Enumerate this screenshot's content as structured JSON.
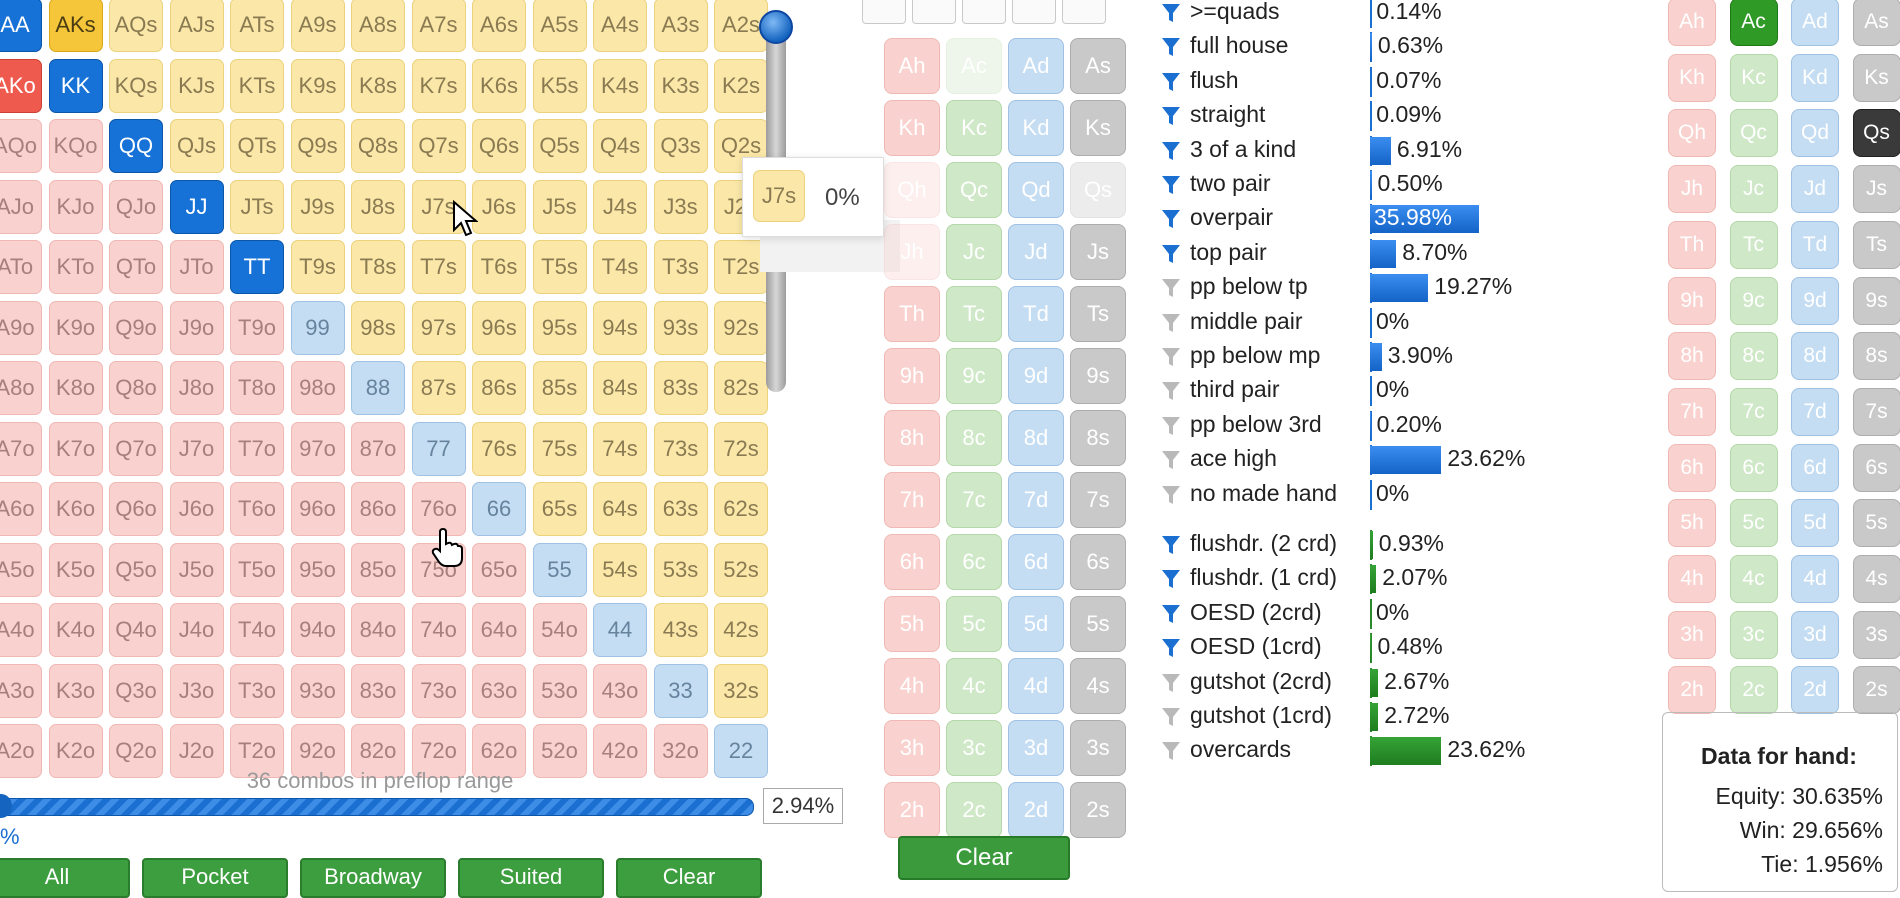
{
  "grid": {
    "ranks": [
      "A",
      "K",
      "Q",
      "J",
      "T",
      "9",
      "8",
      "7",
      "6",
      "5",
      "4",
      "3",
      "2"
    ],
    "selected": {
      "AA": "sel-blue",
      "AKs": "sel-gold",
      "AKo": "sel-red",
      "KK": "sel-blue",
      "QQ": "sel-blue",
      "JJ": "sel-blue",
      "TT": "sel-blue"
    }
  },
  "tooltip": {
    "hand": "J7s",
    "pct": "0%"
  },
  "combos_text": "36 combos in preflop range",
  "range_pct": "2.94%",
  "range_pct_left": "%",
  "range_buttons": [
    "All",
    "Pocket",
    "Broadway",
    "Suited",
    "Clear"
  ],
  "board": {
    "ranks": [
      "A",
      "K",
      "Q",
      "J",
      "T",
      "9",
      "8",
      "7",
      "6",
      "5",
      "4",
      "3",
      "2"
    ],
    "suits": [
      "h",
      "c",
      "d",
      "s"
    ],
    "dimmed": [
      "Ac",
      "Qh",
      "Qs",
      "Jh"
    ],
    "clear_label": "Clear"
  },
  "stats": {
    "made": [
      {
        "label": ">=quads",
        "value": "0.14%",
        "pct": 0.14,
        "filter": "blue"
      },
      {
        "label": "full house",
        "value": "0.63%",
        "pct": 0.63,
        "filter": "blue"
      },
      {
        "label": "flush",
        "value": "0.07%",
        "pct": 0.07,
        "filter": "blue"
      },
      {
        "label": "straight",
        "value": "0.09%",
        "pct": 0.09,
        "filter": "blue"
      },
      {
        "label": "3 of a kind",
        "value": "6.91%",
        "pct": 6.91,
        "filter": "blue"
      },
      {
        "label": "two pair",
        "value": "0.50%",
        "pct": 0.5,
        "filter": "blue"
      },
      {
        "label": "overpair",
        "value": "35.98%",
        "pct": 35.98,
        "filter": "blue"
      },
      {
        "label": "top pair",
        "value": "8.70%",
        "pct": 8.7,
        "filter": "blue"
      },
      {
        "label": "pp below tp",
        "value": "19.27%",
        "pct": 19.27,
        "filter": "gray"
      },
      {
        "label": "middle pair",
        "value": "0%",
        "pct": 0,
        "filter": "gray"
      },
      {
        "label": "pp below mp",
        "value": "3.90%",
        "pct": 3.9,
        "filter": "gray"
      },
      {
        "label": "third pair",
        "value": "0%",
        "pct": 0,
        "filter": "gray"
      },
      {
        "label": "pp below 3rd",
        "value": "0.20%",
        "pct": 0.2,
        "filter": "gray"
      },
      {
        "label": "ace high",
        "value": "23.62%",
        "pct": 23.62,
        "filter": "gray"
      },
      {
        "label": "no made hand",
        "value": "0%",
        "pct": 0,
        "filter": "gray"
      }
    ],
    "draws": [
      {
        "label": "flushdr. (2 crd)",
        "value": "0.93%",
        "pct": 0.93,
        "filter": "blue"
      },
      {
        "label": "flushdr. (1 crd)",
        "value": "2.07%",
        "pct": 2.07,
        "filter": "blue"
      },
      {
        "label": "OESD (2crd)",
        "value": "0%",
        "pct": 0,
        "filter": "blue"
      },
      {
        "label": "OESD (1crd)",
        "value": "0.48%",
        "pct": 0.48,
        "filter": "blue"
      },
      {
        "label": "gutshot (2crd)",
        "value": "2.67%",
        "pct": 2.67,
        "filter": "gray"
      },
      {
        "label": "gutshot (1crd)",
        "value": "2.72%",
        "pct": 2.72,
        "filter": "gray"
      },
      {
        "label": "overcards",
        "value": "23.62%",
        "pct": 23.62,
        "filter": "gray"
      }
    ]
  },
  "hand_picker": {
    "selected": {
      "Ac": "sel-green",
      "Qs": "sel-blk"
    }
  },
  "data_box": {
    "title": "Data for hand:",
    "equity": "Equity: 30.635%",
    "win": "Win: 29.656%",
    "tie": "Tie: 1.956%"
  },
  "colors": {
    "blue": "#1a6fd1",
    "green": "#3a9a3c",
    "suited": "#fbe8a8",
    "offsuit": "#f9d2cf",
    "pair": "#c5ddf3"
  }
}
